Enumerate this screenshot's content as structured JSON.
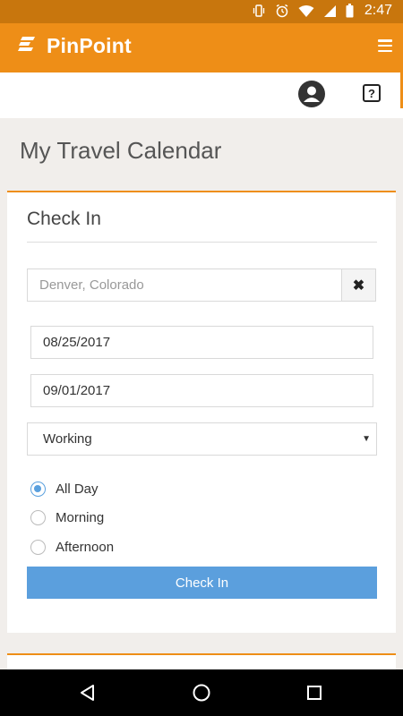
{
  "status_bar": {
    "time": "2:47",
    "icons": [
      "vibrate-icon",
      "alarm-icon",
      "wifi-icon",
      "cellular-signal-icon",
      "battery-icon"
    ]
  },
  "app_bar": {
    "brand": "PinPoint",
    "logo_icon": "pinpoint-logo-icon",
    "menu_icon": "hamburger-menu-icon",
    "color": "#ee8e17"
  },
  "toolbar": {
    "profile_icon": "user-avatar-icon",
    "help_label": "?"
  },
  "page": {
    "title": "My Travel Calendar"
  },
  "check_in": {
    "title": "Check In",
    "location_value": "Denver, Colorado",
    "clear_label": "✖",
    "start_date": "08/25/2017",
    "end_date": "09/01/2017",
    "status_selected": "Working",
    "status_caret": "▼",
    "time_options": [
      {
        "label": "All Day",
        "checked": true
      },
      {
        "label": "Morning",
        "checked": false
      },
      {
        "label": "Afternoon",
        "checked": false
      }
    ],
    "submit_label": "Check In",
    "accent_color": "#5b9fdd"
  },
  "nav_bar": {
    "buttons": [
      "back-icon",
      "home-icon",
      "recents-icon"
    ]
  }
}
